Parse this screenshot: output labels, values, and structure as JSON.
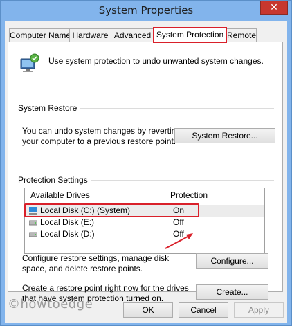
{
  "window": {
    "title": "System Properties",
    "close_label": "✕"
  },
  "tabs": [
    {
      "label": "Computer Name"
    },
    {
      "label": "Hardware"
    },
    {
      "label": "Advanced"
    },
    {
      "label": "System Protection"
    },
    {
      "label": "Remote"
    }
  ],
  "intro": "Use system protection to undo unwanted system changes.",
  "system_restore": {
    "group_label": "System Restore",
    "description": "You can undo system changes by reverting your computer to a previous restore point.",
    "button_label": "System Restore..."
  },
  "protection_settings": {
    "group_label": "Protection Settings",
    "columns": [
      "Available Drives",
      "Protection"
    ],
    "drives": [
      {
        "name": "Local Disk (C:) (System)",
        "protection": "On"
      },
      {
        "name": "Local Disk (E:)",
        "protection": "Off"
      },
      {
        "name": "Local Disk (D:)",
        "protection": "Off"
      }
    ],
    "configure_text": "Configure restore settings, manage disk space, and delete restore points.",
    "configure_label": "Configure...",
    "create_text": "Create a restore point right now for the drives that have system protection turned on.",
    "create_label": "Create..."
  },
  "footer": {
    "ok_label": "OK",
    "cancel_label": "Cancel",
    "apply_label": "Apply"
  },
  "watermark": "©howtoedge",
  "colors": {
    "highlight": "#d9202a",
    "title_bar": "#82b4ec",
    "close_button": "#c7372f"
  }
}
